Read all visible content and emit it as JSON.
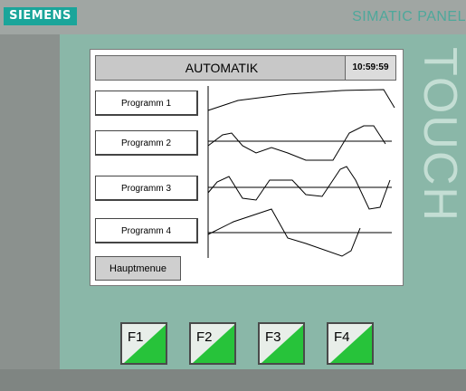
{
  "header": {
    "brand": "SIEMENS",
    "panel_title": "SIMATIC PANEL",
    "side_label": "TOUCH"
  },
  "screen": {
    "title": "AUTOMATIK",
    "clock": "10:59:59",
    "programs": [
      "Programm 1",
      "Programm 2",
      "Programm 3",
      "Programm 4"
    ],
    "menu_button": "Hauptmenue"
  },
  "function_keys": [
    "F1",
    "F2",
    "F3",
    "F4"
  ],
  "colors": {
    "bezel": "#8ab7a8",
    "brand": "#1aa59a",
    "key_accent": "#27c33a"
  }
}
